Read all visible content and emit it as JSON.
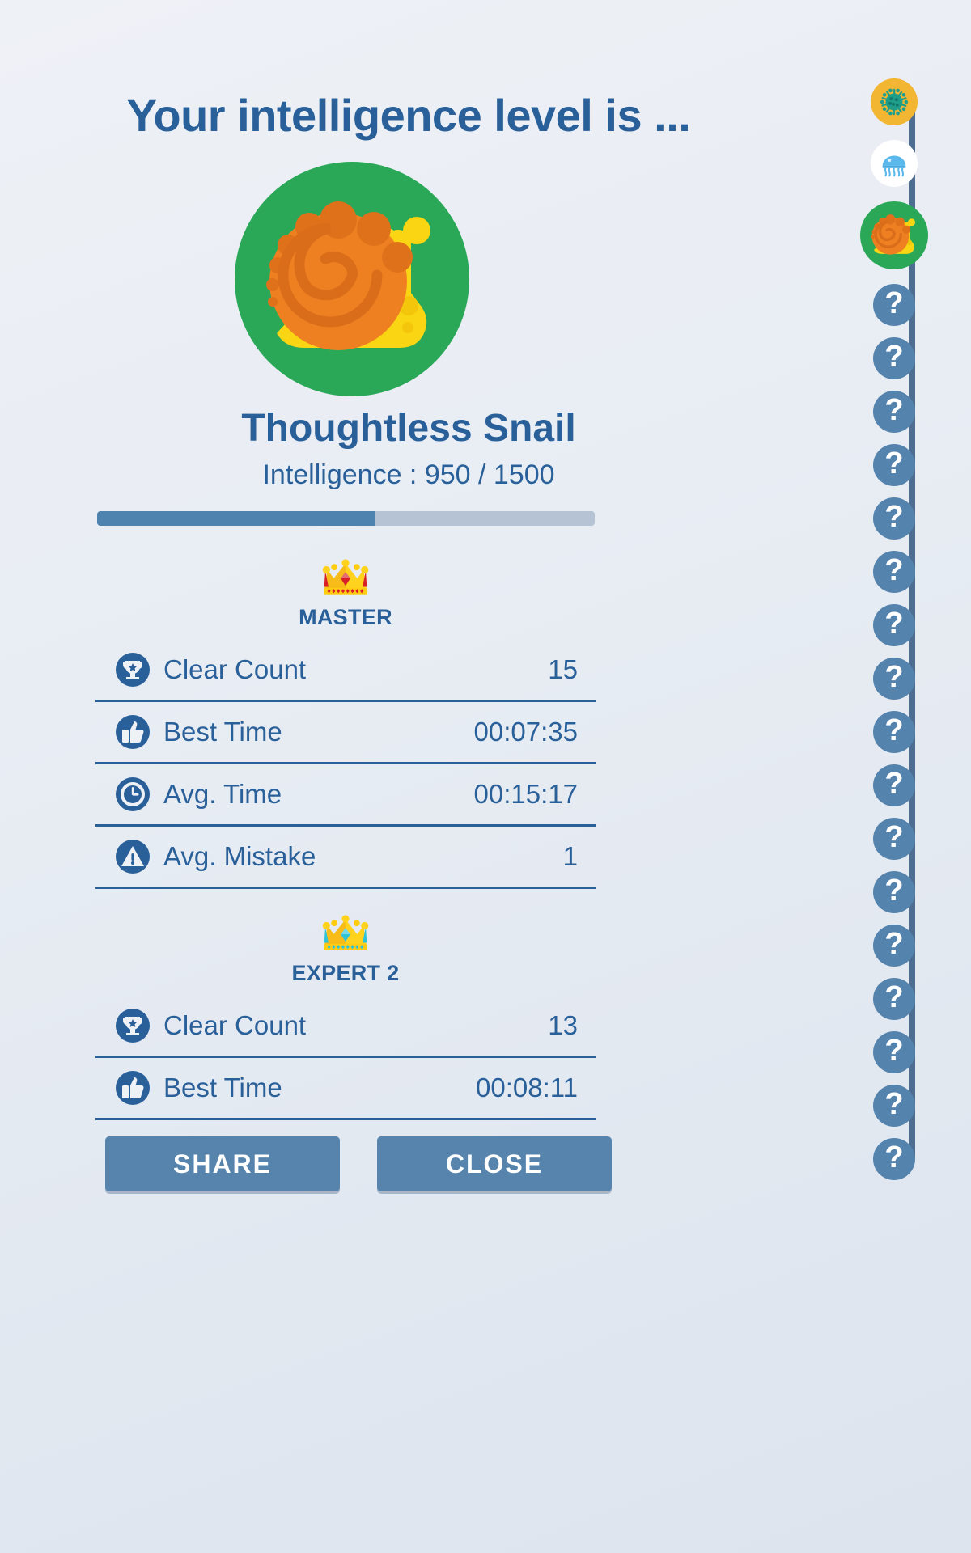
{
  "header": {
    "title": "Your intelligence level is ..."
  },
  "hero": {
    "badge_icon": "snail-icon",
    "badge_bg_color": "#2aa858",
    "shell_color": "#ef8022",
    "shell_dark_color": "#d96d1a",
    "body_color": "#f9d513",
    "level_name": "Thoughtless Snail",
    "intelligence_line": "Intelligence : 950 / 1500",
    "intelligence_current": 950,
    "intelligence_max": 1500,
    "progress_percent": 56,
    "progress_fill_color": "#4d83ae",
    "progress_track_color": "#b5c3d4"
  },
  "sections": [
    {
      "rank_label": "MASTER",
      "crown_icon": "crown-icon",
      "crown_gem_color": "#d81f26",
      "crown_body_color": "#ffd21e",
      "rows": [
        {
          "icon": "trophy-icon",
          "label": "Clear Count",
          "value": "15"
        },
        {
          "icon": "thumbs-up-icon",
          "label": "Best Time",
          "value": "00:07:35"
        },
        {
          "icon": "clock-icon",
          "label": "Avg. Time",
          "value": "00:15:17"
        },
        {
          "icon": "warning-icon",
          "label": "Avg. Mistake",
          "value": "1"
        }
      ]
    },
    {
      "rank_label": "EXPERT 2",
      "crown_icon": "crown-icon",
      "crown_gem_color": "#2fc4d8",
      "crown_body_color": "#ffd21e",
      "rows": [
        {
          "icon": "trophy-icon",
          "label": "Clear Count",
          "value": "13"
        },
        {
          "icon": "thumbs-up-icon",
          "label": "Best Time",
          "value": "00:08:11"
        }
      ]
    }
  ],
  "footer": {
    "share_label": "SHARE",
    "close_label": "CLOSE",
    "button_color": "#5684ad"
  },
  "rail": {
    "line_color": "#4d6e92",
    "locked_symbol": "?",
    "nodes": [
      {
        "type": "germ",
        "icon": "germ-icon",
        "label": ""
      },
      {
        "type": "jelly",
        "icon": "jellyfish-icon",
        "label": ""
      },
      {
        "type": "snail",
        "icon": "snail-icon",
        "label": ""
      },
      {
        "type": "locked",
        "icon": "question-icon",
        "label": "?"
      },
      {
        "type": "locked",
        "icon": "question-icon",
        "label": "?"
      },
      {
        "type": "locked",
        "icon": "question-icon",
        "label": "?"
      },
      {
        "type": "locked",
        "icon": "question-icon",
        "label": "?"
      },
      {
        "type": "locked",
        "icon": "question-icon",
        "label": "?"
      },
      {
        "type": "locked",
        "icon": "question-icon",
        "label": "?"
      },
      {
        "type": "locked",
        "icon": "question-icon",
        "label": "?"
      },
      {
        "type": "locked",
        "icon": "question-icon",
        "label": "?"
      },
      {
        "type": "locked",
        "icon": "question-icon",
        "label": "?"
      },
      {
        "type": "locked",
        "icon": "question-icon",
        "label": "?"
      },
      {
        "type": "locked",
        "icon": "question-icon",
        "label": "?"
      },
      {
        "type": "locked",
        "icon": "question-icon",
        "label": "?"
      },
      {
        "type": "locked",
        "icon": "question-icon",
        "label": "?"
      },
      {
        "type": "locked",
        "icon": "question-icon",
        "label": "?"
      },
      {
        "type": "locked",
        "icon": "question-icon",
        "label": "?"
      },
      {
        "type": "locked",
        "icon": "question-icon",
        "label": "?"
      },
      {
        "type": "locked",
        "icon": "question-icon",
        "label": "?"
      }
    ]
  }
}
